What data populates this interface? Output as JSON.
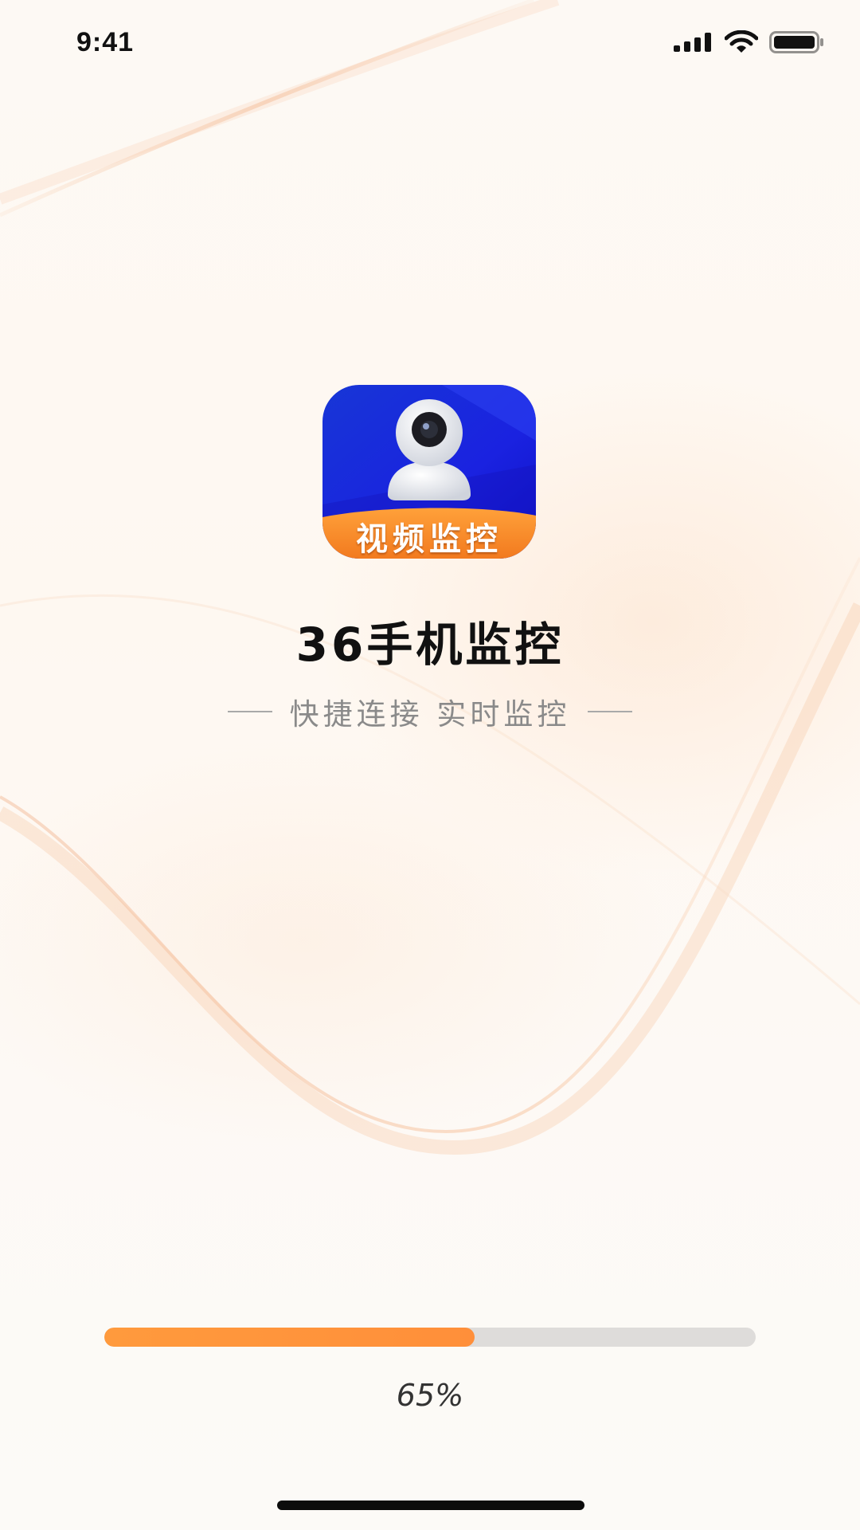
{
  "status_bar": {
    "time": "9:41"
  },
  "splash": {
    "icon_label": "视频监控",
    "title": "36手机监控",
    "subtitle": "快捷连接 实时监控"
  },
  "loading": {
    "progress_percent": 65,
    "progress_text": "65%"
  },
  "colors": {
    "accent": "#ff9a3d",
    "icon_blue": "#1a2bd8",
    "icon_orange": "#f7892a",
    "track": "#dedcda"
  },
  "icons": {
    "signal": "cellular-signal-icon",
    "wifi": "wifi-icon",
    "battery": "battery-icon",
    "app": "security-camera-app-icon"
  }
}
